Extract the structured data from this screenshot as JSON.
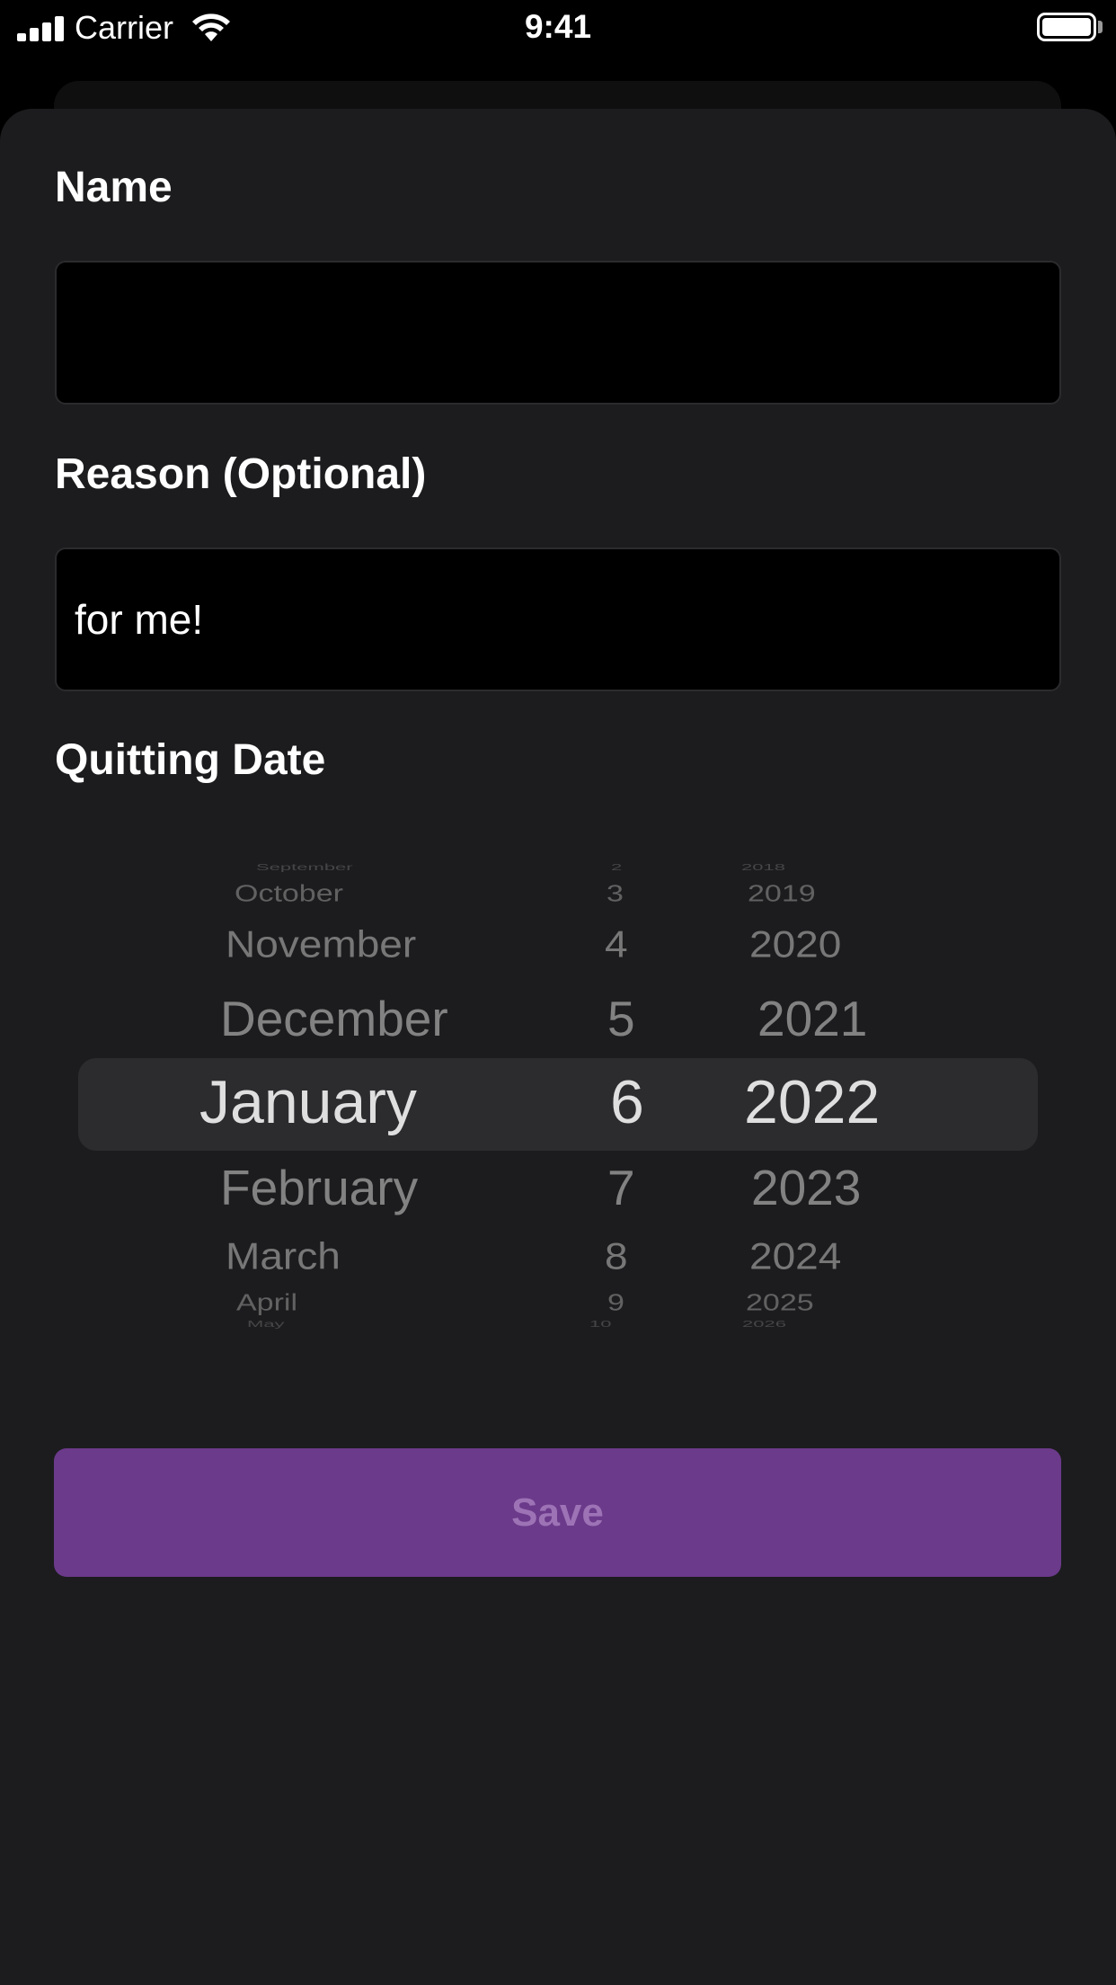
{
  "status_bar": {
    "carrier": "Carrier",
    "time": "9:41",
    "icons": [
      "signal-icon",
      "wifi-icon",
      "battery-icon"
    ]
  },
  "form": {
    "name_label": "Name",
    "name_value": "",
    "reason_label": "Reason (Optional)",
    "reason_value": "for me!",
    "date_label": "Quitting Date"
  },
  "date_picker": {
    "months": [
      "September",
      "October",
      "November",
      "December",
      "January",
      "February",
      "March",
      "April",
      "May"
    ],
    "days": [
      "2",
      "3",
      "4",
      "5",
      "6",
      "7",
      "8",
      "9",
      "10"
    ],
    "years": [
      "2018",
      "2019",
      "2020",
      "2021",
      "2022",
      "2023",
      "2024",
      "2025",
      "2026"
    ],
    "selected": {
      "month": "January",
      "day": "6",
      "year": "2022"
    }
  },
  "save_label": "Save",
  "colors": {
    "background": "#000000",
    "sheet": "#1c1c1e",
    "save_button": "#6b3a8a",
    "save_text": "#9d73b6"
  }
}
